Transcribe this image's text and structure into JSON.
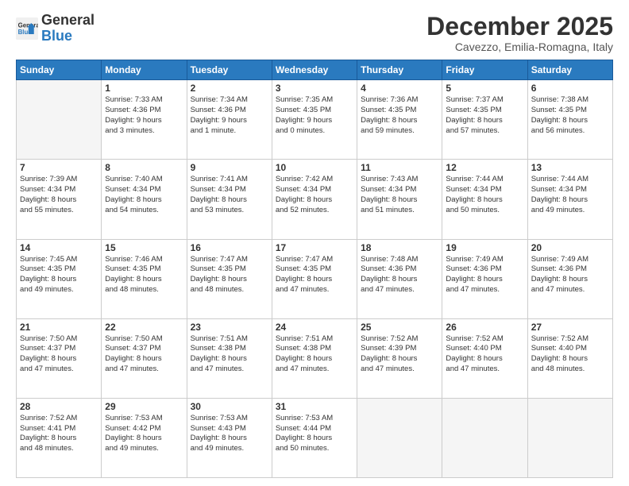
{
  "logo": {
    "line1": "General",
    "line2": "Blue"
  },
  "header": {
    "month": "December 2025",
    "location": "Cavezzo, Emilia-Romagna, Italy"
  },
  "weekdays": [
    "Sunday",
    "Monday",
    "Tuesday",
    "Wednesday",
    "Thursday",
    "Friday",
    "Saturday"
  ],
  "weeks": [
    [
      {
        "day": "",
        "info": ""
      },
      {
        "day": "1",
        "info": "Sunrise: 7:33 AM\nSunset: 4:36 PM\nDaylight: 9 hours\nand 3 minutes."
      },
      {
        "day": "2",
        "info": "Sunrise: 7:34 AM\nSunset: 4:36 PM\nDaylight: 9 hours\nand 1 minute."
      },
      {
        "day": "3",
        "info": "Sunrise: 7:35 AM\nSunset: 4:35 PM\nDaylight: 9 hours\nand 0 minutes."
      },
      {
        "day": "4",
        "info": "Sunrise: 7:36 AM\nSunset: 4:35 PM\nDaylight: 8 hours\nand 59 minutes."
      },
      {
        "day": "5",
        "info": "Sunrise: 7:37 AM\nSunset: 4:35 PM\nDaylight: 8 hours\nand 57 minutes."
      },
      {
        "day": "6",
        "info": "Sunrise: 7:38 AM\nSunset: 4:35 PM\nDaylight: 8 hours\nand 56 minutes."
      }
    ],
    [
      {
        "day": "7",
        "info": "Sunrise: 7:39 AM\nSunset: 4:34 PM\nDaylight: 8 hours\nand 55 minutes."
      },
      {
        "day": "8",
        "info": "Sunrise: 7:40 AM\nSunset: 4:34 PM\nDaylight: 8 hours\nand 54 minutes."
      },
      {
        "day": "9",
        "info": "Sunrise: 7:41 AM\nSunset: 4:34 PM\nDaylight: 8 hours\nand 53 minutes."
      },
      {
        "day": "10",
        "info": "Sunrise: 7:42 AM\nSunset: 4:34 PM\nDaylight: 8 hours\nand 52 minutes."
      },
      {
        "day": "11",
        "info": "Sunrise: 7:43 AM\nSunset: 4:34 PM\nDaylight: 8 hours\nand 51 minutes."
      },
      {
        "day": "12",
        "info": "Sunrise: 7:44 AM\nSunset: 4:34 PM\nDaylight: 8 hours\nand 50 minutes."
      },
      {
        "day": "13",
        "info": "Sunrise: 7:44 AM\nSunset: 4:34 PM\nDaylight: 8 hours\nand 49 minutes."
      }
    ],
    [
      {
        "day": "14",
        "info": "Sunrise: 7:45 AM\nSunset: 4:35 PM\nDaylight: 8 hours\nand 49 minutes."
      },
      {
        "day": "15",
        "info": "Sunrise: 7:46 AM\nSunset: 4:35 PM\nDaylight: 8 hours\nand 48 minutes."
      },
      {
        "day": "16",
        "info": "Sunrise: 7:47 AM\nSunset: 4:35 PM\nDaylight: 8 hours\nand 48 minutes."
      },
      {
        "day": "17",
        "info": "Sunrise: 7:47 AM\nSunset: 4:35 PM\nDaylight: 8 hours\nand 47 minutes."
      },
      {
        "day": "18",
        "info": "Sunrise: 7:48 AM\nSunset: 4:36 PM\nDaylight: 8 hours\nand 47 minutes."
      },
      {
        "day": "19",
        "info": "Sunrise: 7:49 AM\nSunset: 4:36 PM\nDaylight: 8 hours\nand 47 minutes."
      },
      {
        "day": "20",
        "info": "Sunrise: 7:49 AM\nSunset: 4:36 PM\nDaylight: 8 hours\nand 47 minutes."
      }
    ],
    [
      {
        "day": "21",
        "info": "Sunrise: 7:50 AM\nSunset: 4:37 PM\nDaylight: 8 hours\nand 47 minutes."
      },
      {
        "day": "22",
        "info": "Sunrise: 7:50 AM\nSunset: 4:37 PM\nDaylight: 8 hours\nand 47 minutes."
      },
      {
        "day": "23",
        "info": "Sunrise: 7:51 AM\nSunset: 4:38 PM\nDaylight: 8 hours\nand 47 minutes."
      },
      {
        "day": "24",
        "info": "Sunrise: 7:51 AM\nSunset: 4:38 PM\nDaylight: 8 hours\nand 47 minutes."
      },
      {
        "day": "25",
        "info": "Sunrise: 7:52 AM\nSunset: 4:39 PM\nDaylight: 8 hours\nand 47 minutes."
      },
      {
        "day": "26",
        "info": "Sunrise: 7:52 AM\nSunset: 4:40 PM\nDaylight: 8 hours\nand 47 minutes."
      },
      {
        "day": "27",
        "info": "Sunrise: 7:52 AM\nSunset: 4:40 PM\nDaylight: 8 hours\nand 48 minutes."
      }
    ],
    [
      {
        "day": "28",
        "info": "Sunrise: 7:52 AM\nSunset: 4:41 PM\nDaylight: 8 hours\nand 48 minutes."
      },
      {
        "day": "29",
        "info": "Sunrise: 7:53 AM\nSunset: 4:42 PM\nDaylight: 8 hours\nand 49 minutes."
      },
      {
        "day": "30",
        "info": "Sunrise: 7:53 AM\nSunset: 4:43 PM\nDaylight: 8 hours\nand 49 minutes."
      },
      {
        "day": "31",
        "info": "Sunrise: 7:53 AM\nSunset: 4:44 PM\nDaylight: 8 hours\nand 50 minutes."
      },
      {
        "day": "",
        "info": ""
      },
      {
        "day": "",
        "info": ""
      },
      {
        "day": "",
        "info": ""
      }
    ]
  ]
}
